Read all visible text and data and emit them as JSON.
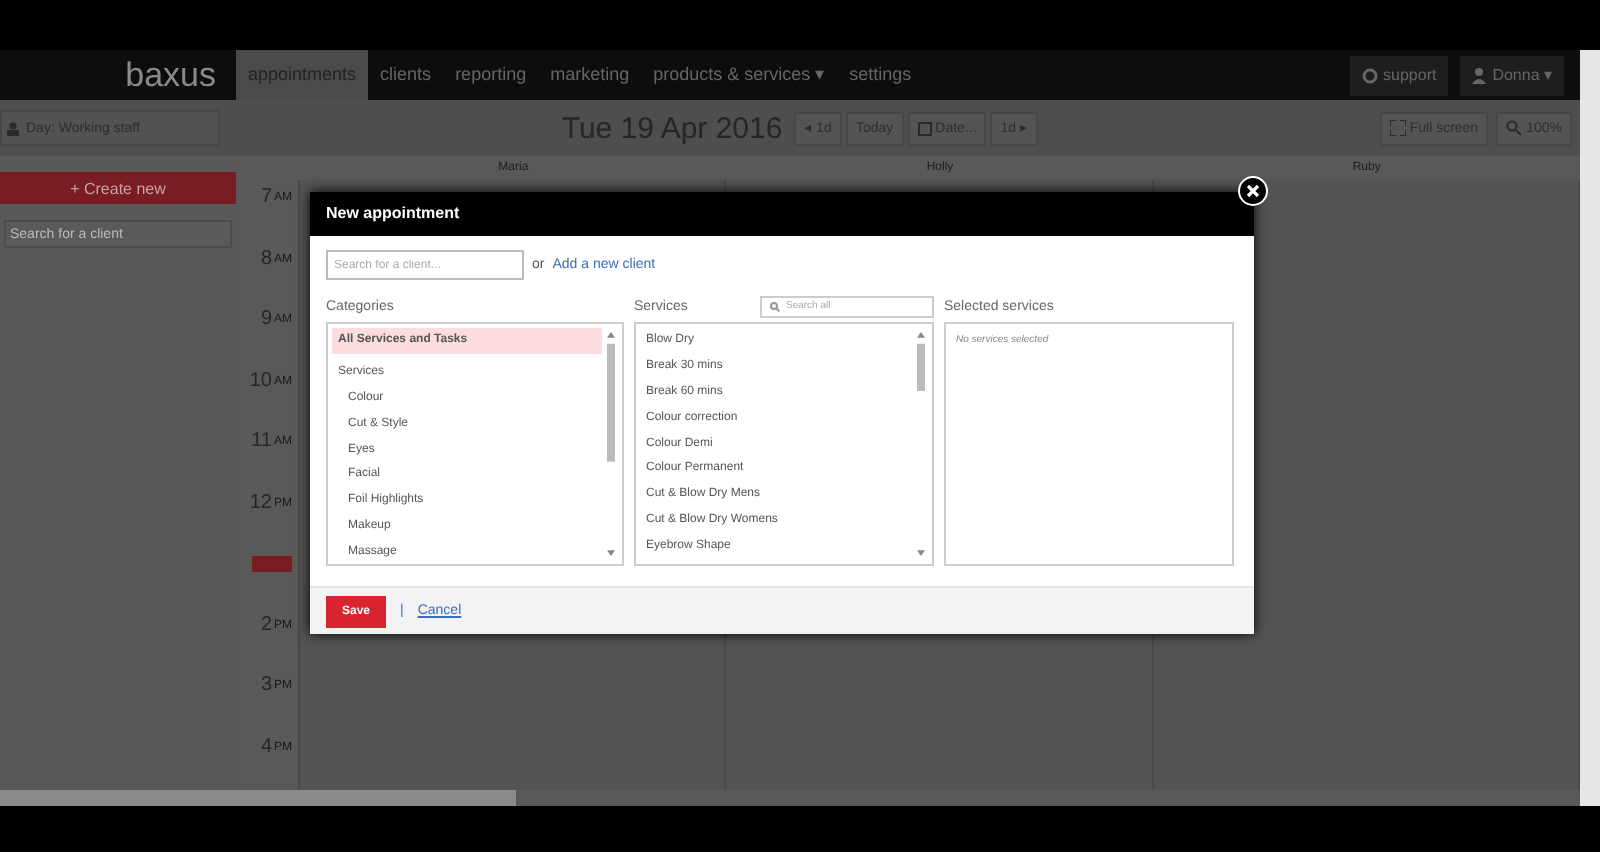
{
  "nav": {
    "logo": "baxus",
    "items": [
      {
        "label": "appointments",
        "selected": true
      },
      {
        "label": "clients",
        "selected": false
      },
      {
        "label": "reporting",
        "selected": false
      },
      {
        "label": "marketing",
        "selected": false
      },
      {
        "label": "products & services ▾",
        "selected": false
      },
      {
        "label": "settings",
        "selected": false
      }
    ],
    "support": "support",
    "user": "Donna ▾"
  },
  "toolbar": {
    "view": "Day: Working staff",
    "date": "Tue 19 Apr 2016",
    "prev": "◂ 1d",
    "today": "Today",
    "pick": "Date...",
    "next": "1d ▸",
    "fullscreen": "Full screen",
    "zoom": "100%"
  },
  "sidebar": {
    "create": "+ Create new",
    "search_placeholder": "Search for a client"
  },
  "calendar": {
    "staff": [
      "Maria",
      "Holly",
      "Ruby"
    ],
    "hours": [
      {
        "kind": "hour",
        "hour": "7",
        "suffix": "AM"
      },
      {
        "kind": "hour",
        "hour": "8",
        "suffix": "AM"
      },
      {
        "kind": "hour",
        "hour": "9",
        "suffix": "AM"
      },
      {
        "kind": "hour",
        "hour": "10",
        "suffix": "AM"
      },
      {
        "kind": "hour",
        "hour": "11",
        "suffix": "AM"
      },
      {
        "kind": "hour",
        "hour": "12",
        "suffix": "PM"
      },
      {
        "kind": "marker"
      },
      {
        "kind": "hour",
        "hour": "2",
        "suffix": "PM"
      },
      {
        "kind": "hour",
        "hour": "3",
        "suffix": "PM"
      },
      {
        "kind": "hour",
        "hour": "4",
        "suffix": "PM"
      }
    ]
  },
  "modal": {
    "title": "New appointment",
    "client_placeholder": "Search for a client...",
    "or": "or",
    "add_client": "Add a new client",
    "categories_label": "Categories",
    "services_label": "Services",
    "services_search_placeholder": "Search all",
    "selected_label": "Selected services",
    "categories": [
      {
        "label": "All Services and Tasks",
        "selected": true
      },
      {
        "label": "Services",
        "selected": false,
        "children": [
          {
            "label": "Colour",
            "selected": false
          },
          {
            "label": "Cut & Style",
            "selected": false
          },
          {
            "label": "Eyes",
            "selected": false
          },
          {
            "label": "Facial",
            "selected": false
          },
          {
            "label": "Foil Highlights",
            "selected": false
          },
          {
            "label": "Makeup",
            "selected": false
          },
          {
            "label": "Massage",
            "selected": false
          }
        ]
      }
    ],
    "services": [
      "Blow Dry",
      "Break 30 mins",
      "Break 60 mins",
      "Colour correction",
      "Colour Demi",
      "Colour Permanent",
      "Cut & Blow Dry Mens",
      "Cut & Blow Dry Womens",
      "Eyebrow Shape"
    ],
    "empty_selected": "No services selected",
    "save": "Save",
    "separator": "|",
    "cancel": "Cancel"
  }
}
